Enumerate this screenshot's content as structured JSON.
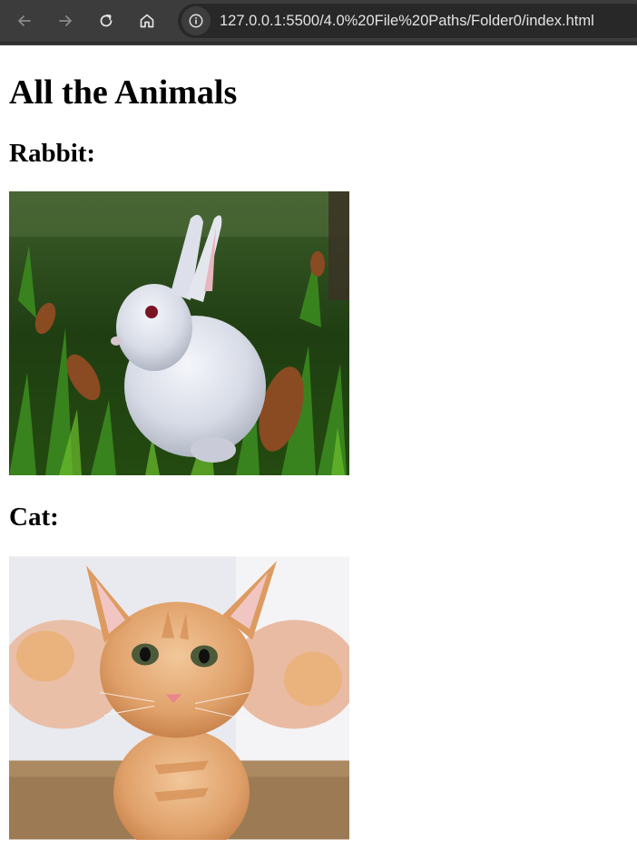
{
  "browser": {
    "url": "127.0.0.1:5500/4.0%20File%20Paths/Folder0/index.html",
    "back_icon": "arrow-left-icon",
    "forward_icon": "arrow-right-icon",
    "reload_icon": "reload-icon",
    "home_icon": "home-icon",
    "site_info_icon": "info-icon"
  },
  "page": {
    "title": "All the Animals",
    "sections": [
      {
        "heading": "Rabbit:",
        "image": "white rabbit sitting in green grass"
      },
      {
        "heading": "Cat:",
        "image": "orange tabby kitten held up by hands"
      }
    ]
  }
}
